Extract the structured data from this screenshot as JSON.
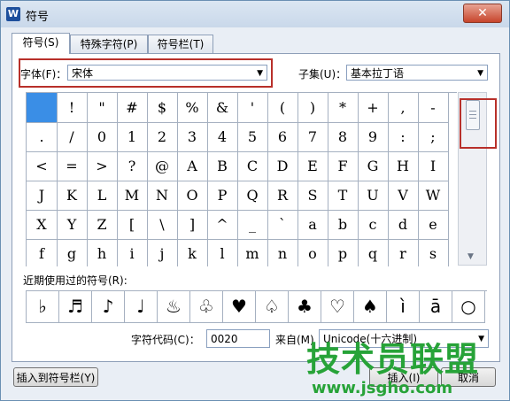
{
  "window": {
    "title": "符号",
    "app_icon": "W",
    "close": "✕"
  },
  "tabs": [
    {
      "label": "符号(S)",
      "active": true
    },
    {
      "label": "特殊字符(P)",
      "active": false
    },
    {
      "label": "符号栏(T)",
      "active": false
    }
  ],
  "font": {
    "label": "字体(F)：",
    "value": "宋体"
  },
  "subset": {
    "label": "子集(U)：",
    "value": "基本拉丁语"
  },
  "symbols": [
    "",
    "!",
    "\"",
    "#",
    "$",
    "%",
    "&",
    "'",
    "(",
    ")",
    "*",
    "+",
    ",",
    "-",
    ".",
    "/",
    "0",
    "1",
    "2",
    "3",
    "4",
    "5",
    "6",
    "7",
    "8",
    "9",
    ":",
    ";",
    "<",
    "=",
    ">",
    "?",
    "@",
    "A",
    "B",
    "C",
    "D",
    "E",
    "F",
    "G",
    "H",
    "I",
    "J",
    "K",
    "L",
    "M",
    "N",
    "O",
    "P",
    "Q",
    "R",
    "S",
    "T",
    "U",
    "V",
    "W",
    "X",
    "Y",
    "Z",
    "[",
    "\\",
    "]",
    "^",
    "_",
    "`",
    "a",
    "b",
    "c",
    "d",
    "e",
    "f",
    "g",
    "h",
    "i",
    "j",
    "k",
    "l",
    "m",
    "n",
    "o",
    "p",
    "q",
    "r",
    "s"
  ],
  "recent": {
    "label": "近期使用过的符号(R):",
    "items": [
      "♭",
      "♬",
      "♪",
      "♩",
      "♨",
      "♧",
      "♥",
      "♤",
      "♣",
      "♡",
      "♠",
      "ì",
      "ā",
      "○"
    ]
  },
  "char_code": {
    "label": "字符代码(C)：",
    "value": "0020"
  },
  "source": {
    "label": "来自(M)",
    "value": "Unicode(十六进制)"
  },
  "buttons": {
    "insert_to_bar": "插入到符号栏(Y)",
    "insert": "插入(I)",
    "cancel": "取消"
  },
  "watermark": {
    "brand": "技术员联盟",
    "url": "www.jsgho.com"
  }
}
